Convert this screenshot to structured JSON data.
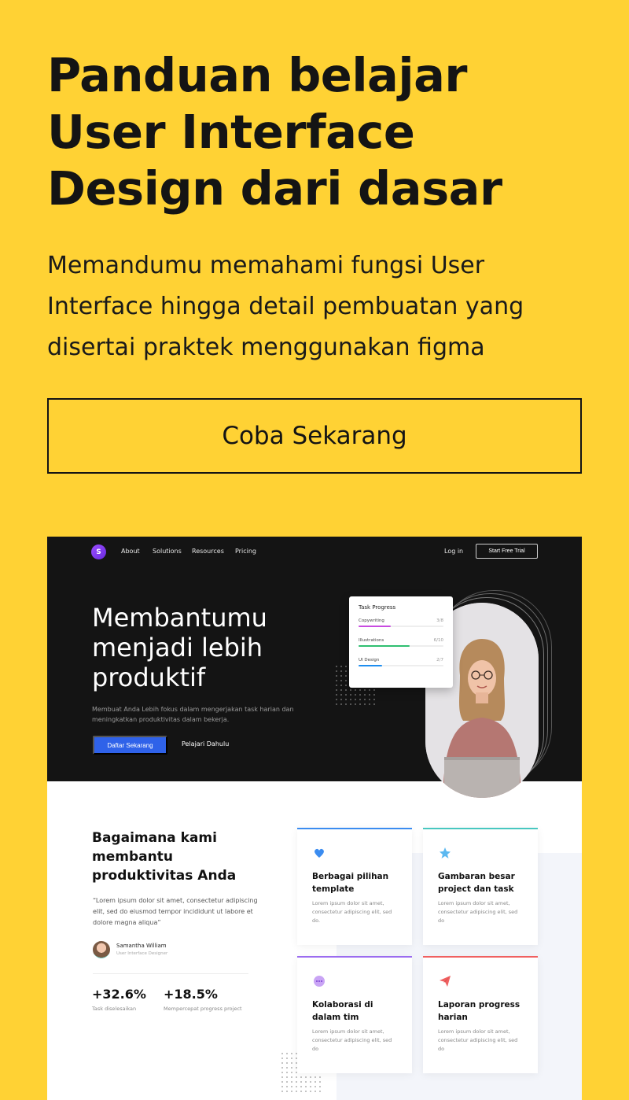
{
  "hero": {
    "title": "Panduan belajar User Interface Design dari dasar",
    "subtitle": "Memandumu memahami fungsi User Interface hingga detail pembuatan yang disertai praktek menggunakan figma",
    "cta_label": "Coba Sekarang"
  },
  "mockup": {
    "nav": {
      "logo_letter": "S",
      "links": [
        "About",
        "Solutions",
        "Resources",
        "Pricing"
      ],
      "login": "Log in",
      "trial": "Start Free Trial"
    },
    "hero": {
      "title": "Membantumu menjadi lebih produktif",
      "description": "Membuat Anda Lebih fokus dalam mengerjakan task harian dan meningkatkan produktivitas dalam bekerja.",
      "primary_button": "Daftar Sekarang",
      "secondary_button": "Pelajari Dahulu"
    },
    "task_progress": {
      "title": "Task Progress",
      "items": [
        {
          "label": "Copywriting",
          "count": "3/8",
          "progress": 0.375,
          "color": "#c84be0"
        },
        {
          "label": "Illustrations",
          "count": "6/10",
          "progress": 0.6,
          "color": "#2fbf71"
        },
        {
          "label": "UI Design",
          "count": "2/7",
          "progress": 0.28,
          "color": "#1e8ef0"
        }
      ]
    },
    "section2": {
      "title": "Bagaimana kami membantu produktivitas Anda",
      "quote": "“Lorem ipsum dolor sit amet, consectetur adipiscing elit, sed do eiusmod tempor incididunt ut labore et dolore magna aliqua”",
      "author": "Samantha William",
      "role": "User Interface Designer",
      "stats": [
        {
          "value": "+32.6%",
          "label": "Task diselesaikan"
        },
        {
          "value": "+18.5%",
          "label": "Mempercepat progress project"
        }
      ]
    },
    "features": [
      {
        "title": "Berbagai pilihan template",
        "desc": "Lorem ipsum dolor sit amet, consectetur adipiscing elit, sed do.",
        "icon": "heart-icon",
        "accent": "#3b8cf0"
      },
      {
        "title": "Gambaran besar project dan task",
        "desc": "Lorem ipsum dolor sit amet, consectetur adipiscing elit, sed do",
        "icon": "star-icon",
        "accent": "#48c7c0"
      },
      {
        "title": "Kolaborasi di dalam tim",
        "desc": "Lorem ipsum dolor sit amet, consectetur adipiscing elit, sed do",
        "icon": "chat-icon",
        "accent": "#9b6cf0"
      },
      {
        "title": "Laporan progress harian",
        "desc": "Lorem ipsum dolor sit amet, consectetur adipiscing elit, sed do",
        "icon": "paper-plane-icon",
        "accent": "#f06060"
      }
    ]
  }
}
